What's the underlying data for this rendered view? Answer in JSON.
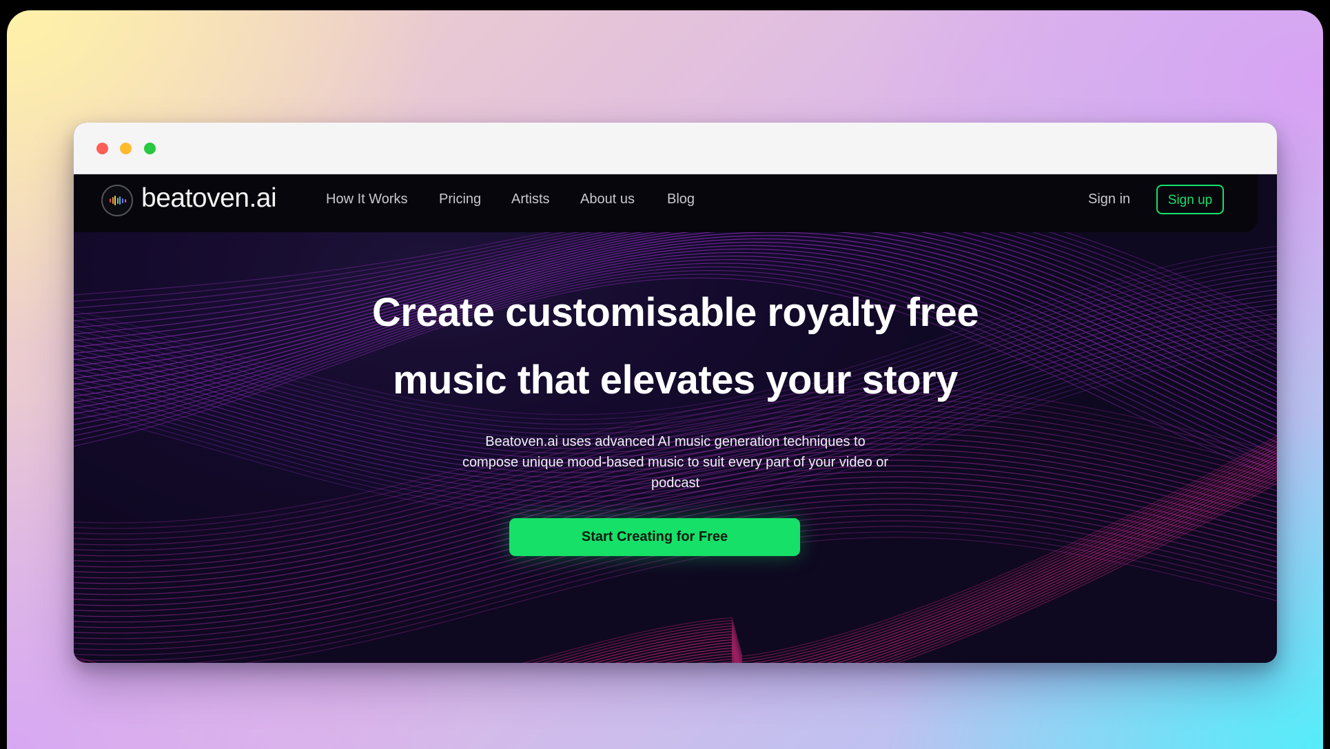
{
  "window": {
    "controls": [
      "close",
      "minimize",
      "maximize"
    ]
  },
  "navbar": {
    "brand": "beatoven.ai",
    "links": [
      {
        "label": "How It Works"
      },
      {
        "label": "Pricing"
      },
      {
        "label": "Artists"
      },
      {
        "label": "About us"
      },
      {
        "label": "Blog"
      }
    ],
    "signin": "Sign in",
    "signup": "Sign up"
  },
  "hero": {
    "title_line1": "Create customisable royalty free",
    "title_line2": "music that elevates your story",
    "subtitle_line1": "Beatoven.ai uses advanced AI music generation techniques to",
    "subtitle_line2": "compose unique mood-based music to suit every part of your video or",
    "subtitle_line3": "podcast",
    "cta": "Start Creating for Free"
  },
  "colors": {
    "accent": "#16e068",
    "window_dot_red": "#fd5f57",
    "window_dot_yellow": "#febb2e",
    "window_dot_green": "#28c840"
  }
}
